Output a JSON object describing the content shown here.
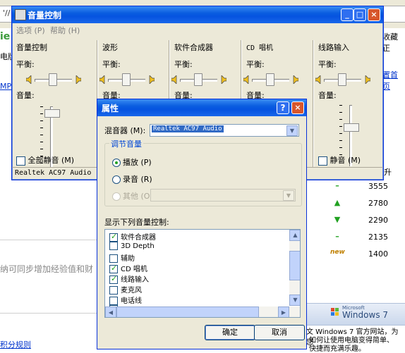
{
  "background": {
    "address_text": "'//",
    "left_labels": [
      "ie",
      "电版",
      "MP"
    ],
    "right_top": "收藏正",
    "right_link": "置首页",
    "right_header": "升",
    "table_rows": [
      {
        "symbol": "–",
        "value": "3555",
        "color": "#21a121"
      },
      {
        "symbol": "▲",
        "value": "2780",
        "color": "#21a121"
      },
      {
        "symbol": "▼",
        "value": "2290",
        "color": "#21a121"
      },
      {
        "symbol": "–",
        "value": "2135",
        "color": "#21a121"
      },
      {
        "symbol": "new",
        "value": "1400",
        "color": "#c08000"
      }
    ],
    "gray_text": "纳可同步增加经验值和财",
    "bottom_link": "积分规则",
    "win7_text": "Windows 7",
    "win7_small": "Microsoft",
    "bottom_text_1": "文 Windows 7 官方网站，为您",
    "bottom_text_2": "如何让使用电脑变得简单、",
    "bottom_text_3": "快捷而充满乐趣。"
  },
  "volume_window": {
    "title": "音量控制",
    "menu": [
      "选项 (P)",
      "帮助 (H)"
    ],
    "columns": [
      {
        "name": "音量控制",
        "balance_label": "平衡:",
        "volume_label": "音量:",
        "mute_label": "全部静音 (M)",
        "muted": false
      },
      {
        "name": "波形",
        "balance_label": "平衡:",
        "volume_label": "音量:"
      },
      {
        "name": "软件合成器",
        "balance_label": "平衡:",
        "volume_label": "音量:"
      },
      {
        "name": "CD 唱机",
        "balance_label": "平衡:",
        "volume_label": "音量:"
      },
      {
        "name": "线路输入",
        "balance_label": "平衡:",
        "volume_label": "音量:",
        "mute_label": "静音 (M)",
        "muted": false
      }
    ],
    "status": "Realtek AC97 Audio"
  },
  "properties_dialog": {
    "title": "属性",
    "mixer_label": "混音器 (M):",
    "mixer_value": "Realtek AC97 Audio",
    "group_title": "调节音量",
    "radio_playback": "播放 (P)",
    "radio_record": "录音 (R)",
    "radio_other": "其他 (O)",
    "selected_radio": "playback",
    "list_label": "显示下列音量控制:",
    "list_items": [
      {
        "label": "软件合成器",
        "checked": true
      },
      {
        "label": "3D Depth",
        "checked": false
      },
      {
        "label": "辅助",
        "checked": false
      },
      {
        "label": "CD 唱机",
        "checked": true
      },
      {
        "label": "线路输入",
        "checked": true
      },
      {
        "label": "麦克风",
        "checked": false
      },
      {
        "label": "电话线",
        "checked": false
      },
      {
        "label": "…",
        "checked": false
      }
    ],
    "ok_label": "确定",
    "cancel_label": "取消"
  }
}
